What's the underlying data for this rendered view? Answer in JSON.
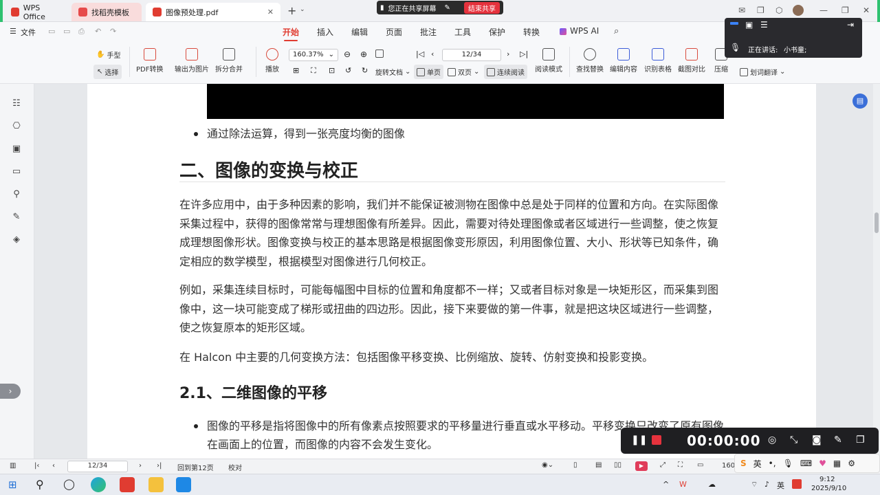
{
  "tabs": [
    {
      "label": "WPS Office"
    },
    {
      "label": "找稻壳模板"
    },
    {
      "label": "图像预处理.pdf"
    }
  ],
  "share": {
    "status": "您正在共享屏幕",
    "end_label": "结束共享"
  },
  "menu": {
    "file": "文件",
    "items": [
      "开始",
      "插入",
      "编辑",
      "页面",
      "批注",
      "工具",
      "保护",
      "转换",
      "WPS AI"
    ],
    "active": "开始"
  },
  "toolbar": {
    "hand": "手型",
    "select": "选择",
    "pdf_convert": "PDF转换",
    "export_image": "输出为图片",
    "split_merge": "拆分合并",
    "play": "播放",
    "zoom": "160.37%",
    "page_current": "12/34",
    "rotate": "旋转文档",
    "single": "单页",
    "double": "双页",
    "continuous": "连续阅读",
    "read_mode": "阅读模式",
    "find_replace": "查找替换",
    "edit_content": "编辑内容",
    "ocr_table": "识别表格",
    "screenshot_compare": "截图对比",
    "compress": "压缩",
    "translate": "划词翻译"
  },
  "speaker": {
    "label": "正在讲话:",
    "name": "小书童;"
  },
  "document": {
    "bullet1": "通过除法运算，得到一张亮度均衡的图像",
    "h2": "二、图像的变换与校正",
    "p1": "在许多应用中，由于多种因素的影响，我们并不能保证被测物在图像中总是处于同样的位置和方向。在实际图像采集过程中，获得的图像常常与理想图像有所差异。因此，需要对待处理图像或者区域进行一些调整，使之恢复成理想图像形状。图像变换与校正的基本思路是根据图像变形原因，利用图像位置、大小、形状等已知条件，确定相应的数学模型，根据模型对图像进行几何校正。",
    "p2": "例如，采集连续目标时，可能每幅图中目标的位置和角度都不一样；又或者目标对象是一块矩形区，而采集到图像中，这一块可能变成了梯形或扭曲的四边形。因此，接下来要做的第一件事，就是把这块区域进行一些调整，使之恢复原本的矩形区域。",
    "p3": "在 Halcon 中主要的几何变换方法：包括图像平移变换、比例缩放、旋转、仿射变换和投影变换。",
    "h3": "2.1、二维图像的平移",
    "bullet2": "图像的平移是指将图像中的所有像素点按照要求的平移量进行垂直或水平移动。平移变换只改变了原有图像在画面上的位置，而图像的内容不会发生变化。"
  },
  "recorder": {
    "time": "00:00:00"
  },
  "status": {
    "page": "12/34",
    "back": "回到第12页",
    "proofread": "校对",
    "zoom": "160"
  },
  "ime": {
    "lang": "英"
  },
  "taskbar": {
    "time": "9:12",
    "date": "2025/9/10"
  }
}
